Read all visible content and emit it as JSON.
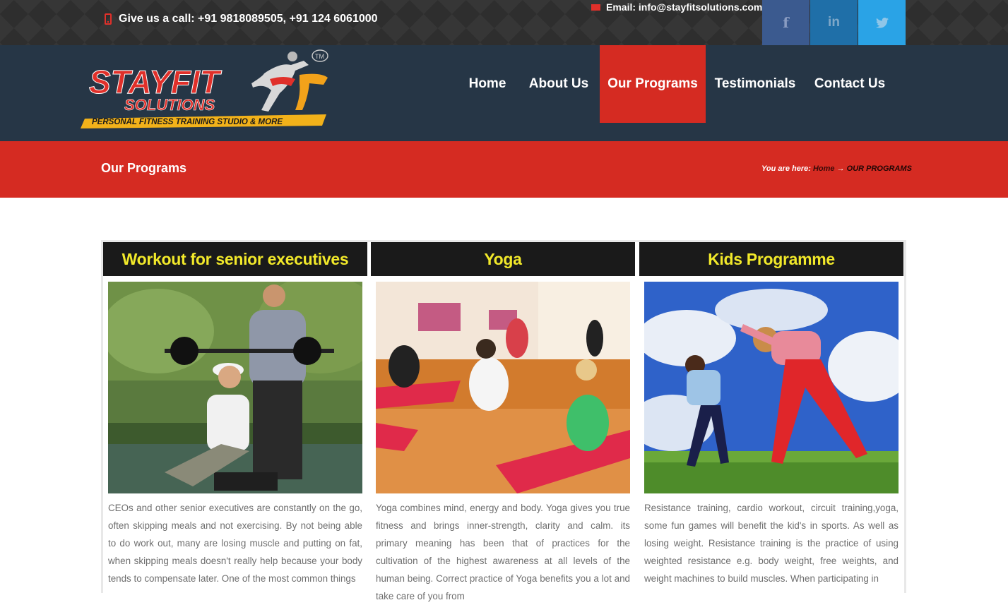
{
  "topbar": {
    "phone_text": "Give us a call: +91 9818089505, +91 124 6061000",
    "email_text": "Email: info@stayfitsolutions.com",
    "social": [
      {
        "icon": "facebook-icon",
        "glyph": "f"
      },
      {
        "icon": "linkedin-icon",
        "glyph": "in"
      },
      {
        "icon": "twitter-icon",
        "glyph": "t"
      }
    ]
  },
  "logo": {
    "word1": "STAYFIT",
    "word2": "SOLUTIONS",
    "tagline": "PERSONAL FITNESS TRAINING STUDIO & MORE",
    "tm": "TM"
  },
  "nav": {
    "items": [
      {
        "label": "Home"
      },
      {
        "label": "About Us"
      },
      {
        "label": "Our Programs"
      },
      {
        "label": "Testimonials"
      },
      {
        "label": "Contact Us"
      }
    ],
    "active": "Our Programs"
  },
  "page_header": {
    "title": "Our Programs",
    "breadcrumb_prefix": "You are here:",
    "breadcrumb_home": "Home",
    "breadcrumb_arrow": "→",
    "breadcrumb_current": "OUR PROGRAMS"
  },
  "programs": [
    {
      "title": "Workout for senior executives",
      "text": "CEOs and other senior executives are constantly on the go, often skipping meals and not exercising. By not being able to do work out, many are losing muscle and putting on fat, when skipping meals doesn't really help because your body tends to compensate later. One of the most common things"
    },
    {
      "title": "Yoga",
      "text": "Yoga combines mind, energy and body. Yoga gives you true fitness and brings inner-strength, clarity and calm. its primary meaning has been that of practices for the cultivation of the highest awareness at all levels of the human being. Correct practice of Yoga benefits you a lot and take care of you from"
    },
    {
      "title": "Kids Programme",
      "text": "Resistance training, cardio workout, circuit training,yoga, some fun games will benefit the kid's in sports. As well as losing weight. Resistance training is the practice of using weighted resistance e.g. body weight, free weights, and weight machines to build muscles. When participating in"
    }
  ],
  "colors": {
    "accent_red": "#d52b22",
    "header_navy": "#263646",
    "card_title_yellow": "#f2e92a"
  }
}
